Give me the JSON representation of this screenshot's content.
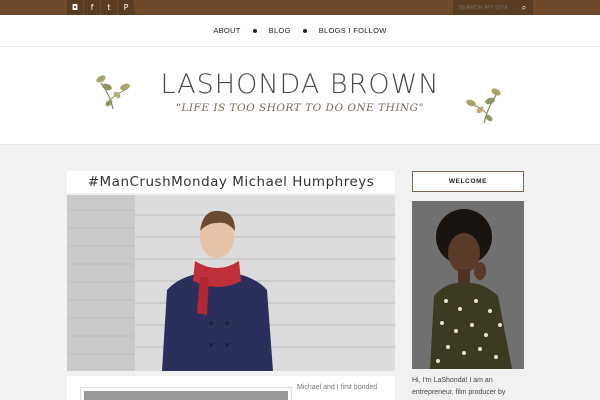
{
  "topbar": {
    "social": [
      {
        "icon": "instagram-icon",
        "glyph": "◘"
      },
      {
        "icon": "facebook-icon",
        "glyph": "f"
      },
      {
        "icon": "twitter-icon",
        "glyph": "t"
      },
      {
        "icon": "pinterest-icon",
        "glyph": "P"
      }
    ],
    "search_placeholder": "SEARCH MY SITE",
    "search_icon": "⌕",
    "colors": {
      "bar": "#6e4a2a",
      "button": "#5a3c22"
    }
  },
  "nav": {
    "items": [
      "ABOUT",
      "BLOG",
      "BLOGS I FOLLOW"
    ]
  },
  "header": {
    "title": "LASHONDA BROWN",
    "tagline": "\"LIFE IS TOO SHORT TO DO ONE THING\""
  },
  "post": {
    "title": "#ManCrushMonday Michael Humphreys",
    "excerpt": "Michael and I first bonded"
  },
  "sidebar": {
    "welcome_label": "WELCOME",
    "bio": "Hi, I'm LaShonda! I am an entrepreneur, film producer by"
  }
}
